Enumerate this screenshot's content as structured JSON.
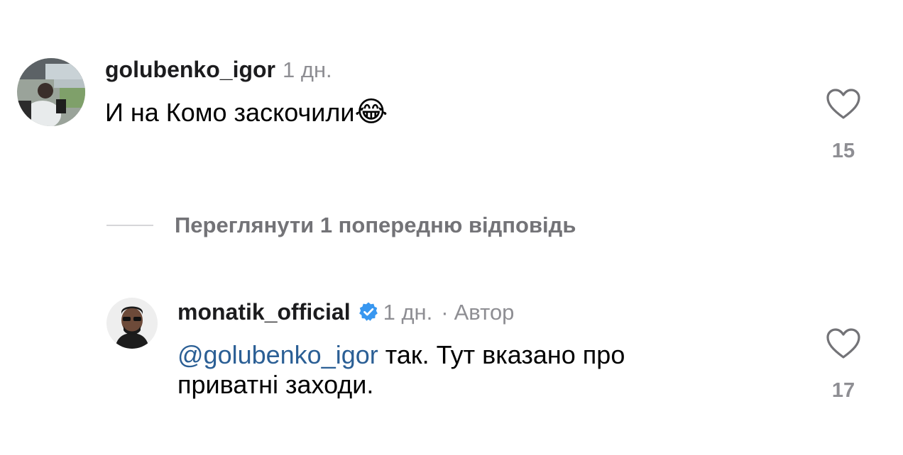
{
  "comments": [
    {
      "username": "golubenko_igor",
      "time": "1 дн.",
      "text": "И на Комо заскочили",
      "emoji": "😂",
      "likes": "15",
      "avatar_icon": "user-driving-car-photo"
    },
    {
      "username": "monatik_official",
      "verified": true,
      "time": "1 дн.",
      "separator": "·",
      "author_label": "Автор",
      "mention": "@golubenko_igor",
      "text_line1": "так. Тут вказано  про",
      "text_line2": "приватні заходи.",
      "likes": "17",
      "avatar_icon": "man-with-sunglasses-photo"
    }
  ],
  "view_replies_label": "Переглянути 1 попередню відповідь",
  "colors": {
    "mention": "#2b5f95",
    "meta": "#8e8e93",
    "verified": "#3897f0"
  }
}
